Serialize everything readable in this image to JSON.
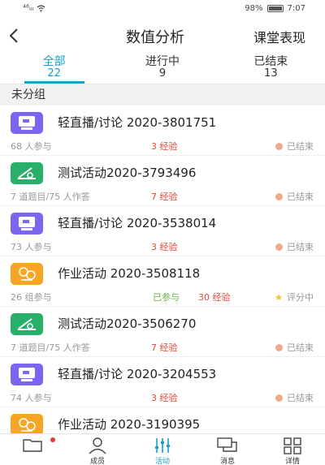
{
  "status_bar": {
    "signal": "⁴⁶ᵢₗₗ",
    "battery": "98%",
    "time": "7:07"
  },
  "nav": {
    "back_icon": "chevron-left-icon",
    "title": "数值分析",
    "right_action": "课堂表现"
  },
  "tabs": [
    {
      "label": "全部",
      "count": "22",
      "active": true
    },
    {
      "label": "进行中",
      "count": "9",
      "active": false
    },
    {
      "label": "已结束",
      "count": "13",
      "active": false
    }
  ],
  "group": {
    "title": "未分组"
  },
  "items": [
    {
      "icon": "broadcast-discussion-icon",
      "color": "purple",
      "title": "轻直播/讨论 2020-3801751",
      "meta": "68 人参与",
      "participated": "",
      "exp": "3 经验",
      "status": "已结束",
      "status_type": "dot"
    },
    {
      "icon": "test-activity-icon",
      "color": "green",
      "title": "测试活动2020-3793496",
      "meta": "7 道题目/75 人作答",
      "participated": "",
      "exp": "7 经验",
      "status": "已结束",
      "status_type": "dot"
    },
    {
      "icon": "broadcast-discussion-icon",
      "color": "purple",
      "title": "轻直播/讨论 2020-3538014",
      "meta": "73 人参与",
      "participated": "",
      "exp": "3 经验",
      "status": "已结束",
      "status_type": "dot"
    },
    {
      "icon": "homework-activity-icon",
      "color": "orange",
      "title": "作业活动 2020-3508118",
      "meta": "26 组参与",
      "participated": "已参与",
      "exp": "30 经验",
      "status": "评分中",
      "status_type": "star"
    },
    {
      "icon": "test-activity-icon",
      "color": "green",
      "title": "测试活动2020-3506270",
      "meta": "7 道题目/75 人作答",
      "participated": "",
      "exp": "7 经验",
      "status": "已结束",
      "status_type": "dot"
    },
    {
      "icon": "broadcast-discussion-icon",
      "color": "purple",
      "title": "轻直播/讨论 2020-3204553",
      "meta": "74 人参与",
      "participated": "",
      "exp": "3 经验",
      "status": "已结束",
      "status_type": "dot"
    },
    {
      "icon": "homework-activity-icon",
      "color": "orange",
      "title": "作业活动 2020-3190395",
      "meta": "",
      "participated": "",
      "exp": "",
      "status": "",
      "status_type": ""
    }
  ],
  "bottom_tabs": [
    {
      "label": "",
      "icon": "folder-icon",
      "active": false,
      "badge": true
    },
    {
      "label": "成员",
      "icon": "members-icon",
      "active": false,
      "badge": false
    },
    {
      "label": "活动",
      "icon": "activity-icon",
      "active": true,
      "badge": false
    },
    {
      "label": "消息",
      "icon": "message-icon",
      "active": false,
      "badge": false
    },
    {
      "label": "详情",
      "icon": "details-icon",
      "active": false,
      "badge": false
    }
  ],
  "colors": {
    "accent": "#1aa0c8",
    "exp_red": "#e0493d",
    "participated_green": "#6ab14a",
    "purple": "#7b66f0",
    "green": "#28b06a",
    "orange": "#f6a623"
  }
}
